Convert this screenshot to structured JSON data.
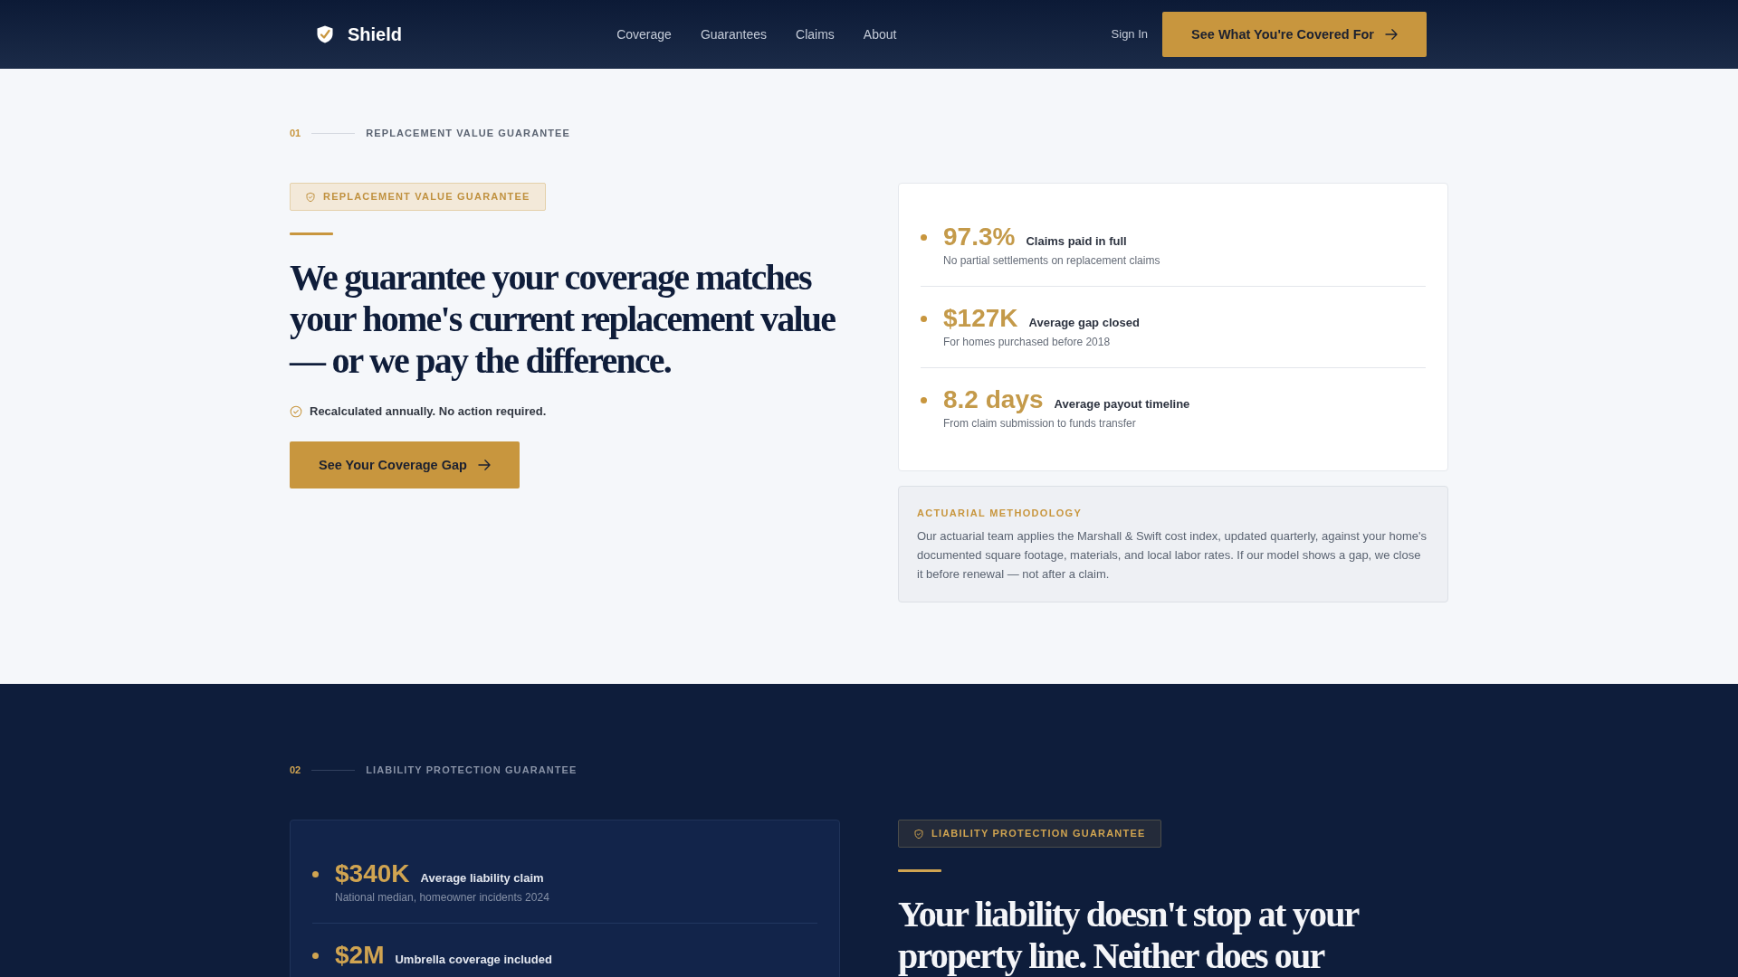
{
  "nav": {
    "brand": "Shield",
    "links": [
      "Coverage",
      "Guarantees",
      "Claims",
      "About"
    ],
    "sign_in": "Sign In",
    "cta": "See What You're Covered For"
  },
  "sections": [
    {
      "kind": "light",
      "reversed": false,
      "number": "01",
      "eyebrow": "REPLACEMENT VALUE GUARANTEE",
      "badge": "REPLACEMENT VALUE GUARANTEE",
      "heading": "We guarantee your coverage matches your home's current replacement value — or we pay the difference.",
      "note": "Recalculated annually. No action required.",
      "button": "See Your Coverage Gap",
      "stats": [
        {
          "value": "97.3%",
          "label": "Claims paid in full",
          "sub": "No partial settlements on replacement claims"
        },
        {
          "value": "$127K",
          "label": "Average gap closed",
          "sub": "For homes purchased before 2018"
        },
        {
          "value": "8.2 days",
          "label": "Average payout timeline",
          "sub": "From claim submission to funds transfer"
        }
      ],
      "methodology": {
        "title": "ACTUARIAL METHODOLOGY",
        "text": "Our actuarial team applies the Marshall & Swift cost index, updated quarterly, against your home's documented square footage, materials, and local labor rates. If our model shows a gap, we close it before renewal — not after a claim."
      }
    },
    {
      "kind": "dark",
      "reversed": true,
      "number": "02",
      "eyebrow": "LIABILITY PROTECTION GUARANTEE",
      "badge": "LIABILITY PROTECTION GUARANTEE",
      "heading": "Your liability doesn't stop at your property line. Neither does our",
      "stats": [
        {
          "value": "$340K",
          "label": "Average liability claim",
          "sub": "National median, homeowner incidents 2024"
        },
        {
          "value": "$2M",
          "label": "Umbrella coverage included"
        }
      ]
    }
  ]
}
